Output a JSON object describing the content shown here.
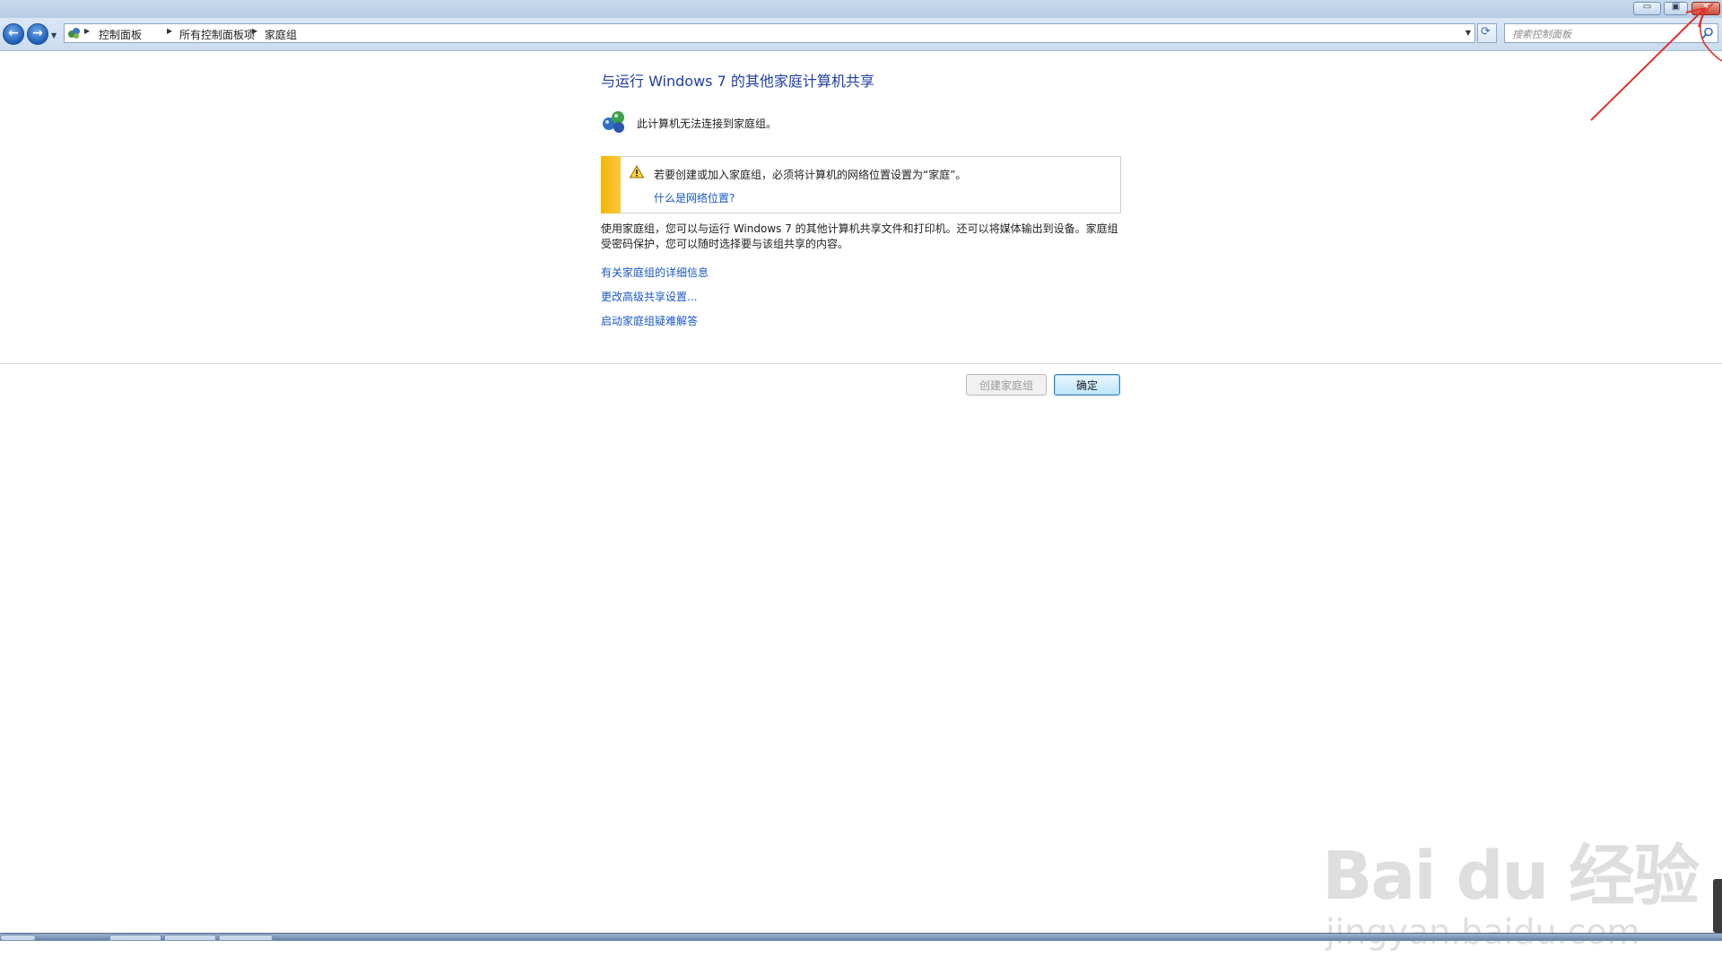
{
  "window": {
    "controls": {
      "minimize": "▭",
      "maximize": "▣",
      "close": "✕"
    }
  },
  "navbar": {
    "back_icon": "back-arrow-icon",
    "forward_icon": "forward-arrow-icon",
    "breadcrumb": [
      "控制面板",
      "所有控制面板项",
      "家庭组"
    ],
    "search_placeholder": "搜索控制面板"
  },
  "main": {
    "title": "与运行 Windows 7 的其他家庭计算机共享",
    "status_text": "此计算机无法连接到家庭组。",
    "warning": {
      "text": "若要创建或加入家庭组，必须将计算机的网络位置设置为“家庭”。",
      "link": "什么是网络位置?"
    },
    "description": "使用家庭组，您可以与运行 Windows 7 的其他计算机共享文件和打印机。还可以将媒体输出到设备。家庭组受密码保护，您可以随时选择要与该组共享的内容。",
    "links": [
      "有关家庭组的详细信息",
      "更改高级共享设置...",
      "启动家庭组疑难解答"
    ]
  },
  "buttons": {
    "create": "创建家庭组",
    "ok": "确定"
  },
  "watermark": {
    "brand": "Bai du 经验",
    "url": "jingyan.baidu.com"
  },
  "colors": {
    "link": "#1a57c7",
    "title": "#1e3da8",
    "warning_strip": "#f4b400",
    "annotation": "#e0322b"
  }
}
